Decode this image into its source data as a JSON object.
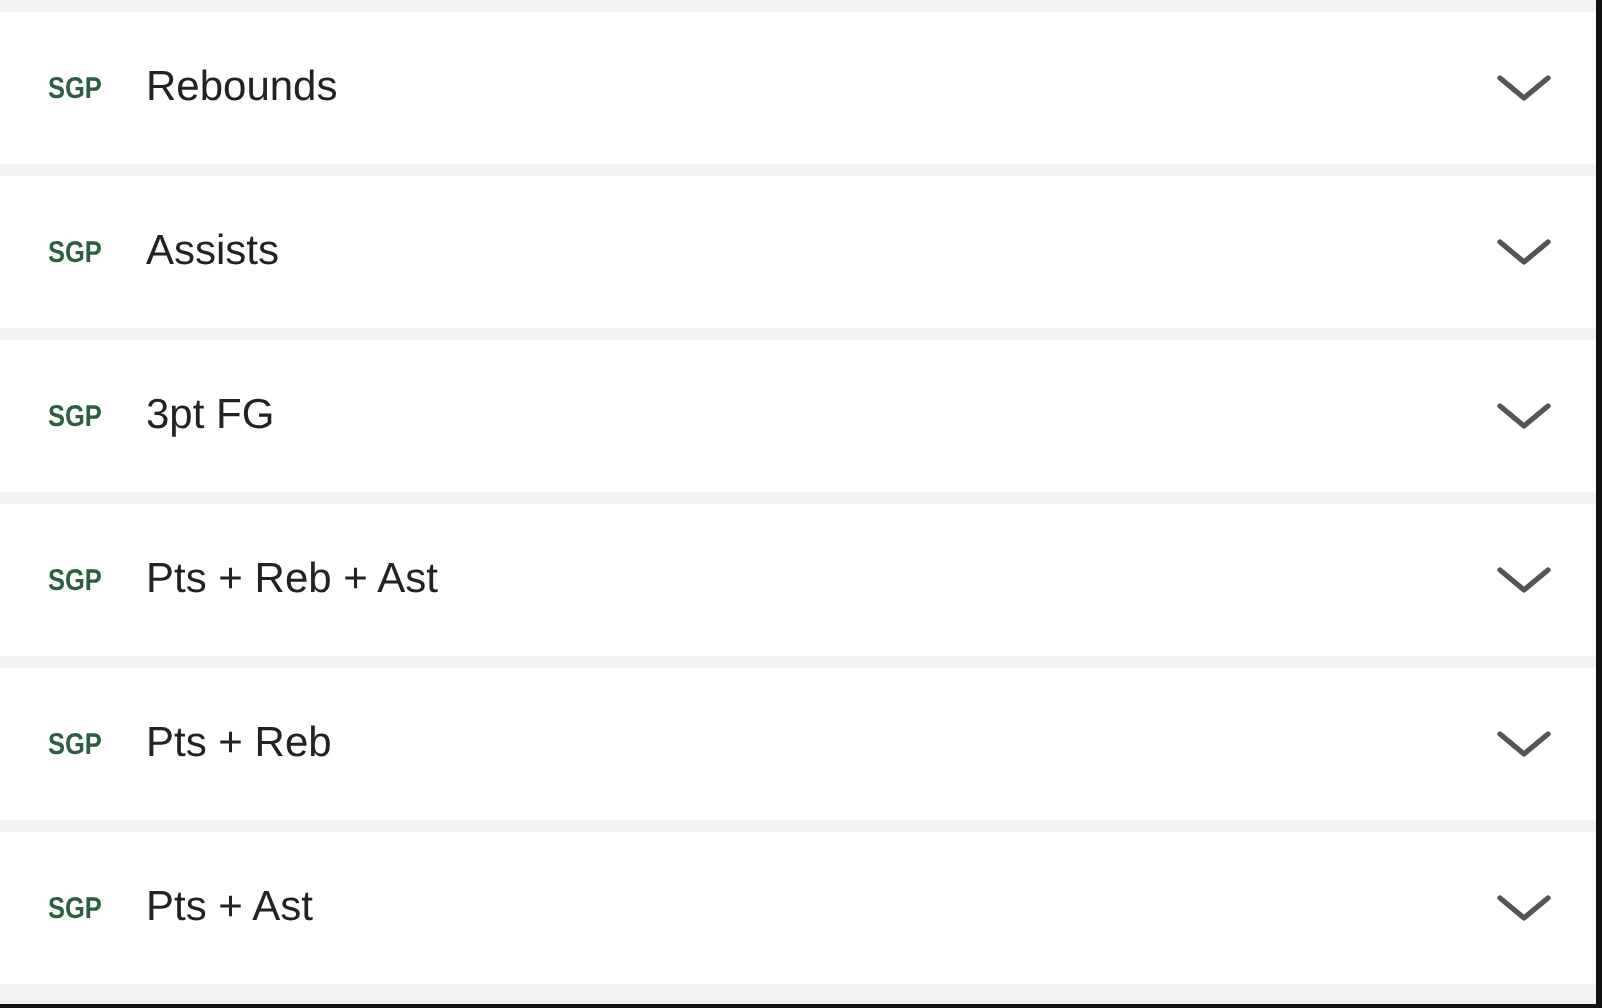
{
  "markets": [
    {
      "badge": "SGP",
      "label": "Rebounds",
      "expanded": false
    },
    {
      "badge": "SGP",
      "label": "Assists",
      "expanded": false
    },
    {
      "badge": "SGP",
      "label": "3pt FG",
      "expanded": false
    },
    {
      "badge": "SGP",
      "label": "Pts + Reb + Ast",
      "expanded": false
    },
    {
      "badge": "SGP",
      "label": "Pts + Reb",
      "expanded": false
    },
    {
      "badge": "SGP",
      "label": "Pts + Ast",
      "expanded": false
    }
  ]
}
